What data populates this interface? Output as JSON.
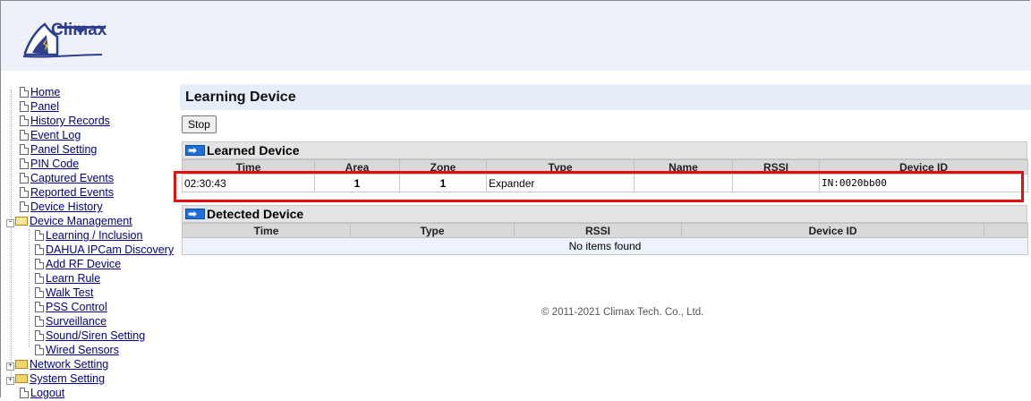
{
  "brand": {
    "name": "Climax"
  },
  "sidebar": {
    "items": [
      {
        "label": "Home"
      },
      {
        "label": "Panel"
      },
      {
        "label": "History Records"
      },
      {
        "label": "Event Log"
      },
      {
        "label": "Panel Setting"
      },
      {
        "label": "PIN Code"
      },
      {
        "label": "Captured Events"
      },
      {
        "label": "Reported Events"
      },
      {
        "label": "Device History"
      },
      {
        "label": "Device Management"
      },
      {
        "label": "Learning / Inclusion"
      },
      {
        "label": "DAHUA IPCam Discovery"
      },
      {
        "label": "Add RF Device"
      },
      {
        "label": "Learn Rule"
      },
      {
        "label": "Walk Test"
      },
      {
        "label": "PSS Control"
      },
      {
        "label": "Surveillance"
      },
      {
        "label": "Sound/Siren Setting"
      },
      {
        "label": "Wired Sensors"
      },
      {
        "label": "Network Setting"
      },
      {
        "label": "System Setting"
      },
      {
        "label": "Logout"
      }
    ]
  },
  "main": {
    "title": "Learning Device",
    "stop_label": "Stop",
    "learned": {
      "heading": "Learned Device",
      "columns": [
        "Time",
        "Area",
        "Zone",
        "Type",
        "Name",
        "RSSI",
        "Device ID"
      ],
      "rows": [
        {
          "time": "02:30:43",
          "area": "1",
          "zone": "1",
          "type": "Expander",
          "name": "",
          "rssi": "",
          "device_id": "IN:0020bb00"
        }
      ]
    },
    "detected": {
      "heading": "Detected Device",
      "columns": [
        "Time",
        "Type",
        "RSSI",
        "Device ID"
      ],
      "empty_text": "No items found"
    }
  },
  "footer": {
    "copyright": "© 2011-2021 Climax Tech. Co., Ltd."
  },
  "colors": {
    "highlight": "#e01010",
    "link": "#000080",
    "header_bg": "#eef1f8"
  }
}
